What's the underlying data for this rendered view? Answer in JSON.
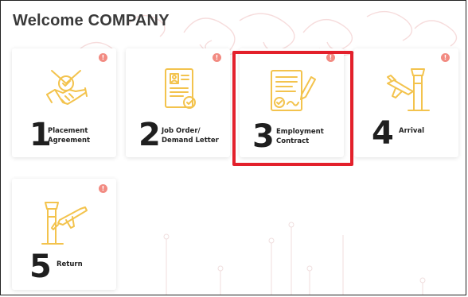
{
  "page": {
    "title": "Welcome COMPANY"
  },
  "colors": {
    "icon": "#f3c34d",
    "badge": "#f28b82",
    "highlight": "#e3202b"
  },
  "steps": [
    {
      "number": "1",
      "label_line1": "Placement",
      "label_line2": "Agreement",
      "icon": "handshake-icon",
      "badge": "!"
    },
    {
      "number": "2",
      "label_line1": "Job Order/",
      "label_line2": "Demand Letter",
      "icon": "document-icon",
      "badge": "!"
    },
    {
      "number": "3",
      "label_line1": "Employment",
      "label_line2": "Contract",
      "icon": "contract-icon",
      "badge": "!"
    },
    {
      "number": "4",
      "label_line1": "Arrival",
      "label_line2": "",
      "icon": "airplane-landing-icon",
      "badge": "!"
    },
    {
      "number": "5",
      "label_line1": "Return",
      "label_line2": "",
      "icon": "airplane-departure-icon",
      "badge": "!"
    }
  ]
}
